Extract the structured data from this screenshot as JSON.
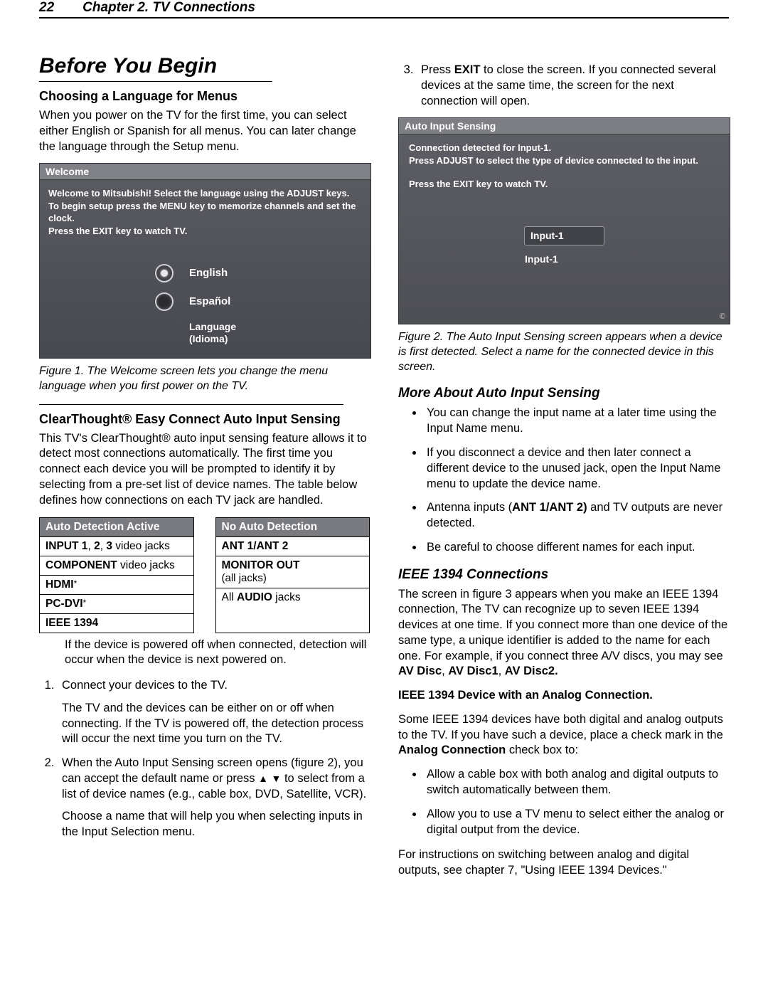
{
  "header": {
    "page_number": "22",
    "chapter": "Chapter 2. TV Connections"
  },
  "left": {
    "h1": "Before You Begin",
    "h2a": "Choosing a Language for Menus",
    "p1": "When you power on the TV for the first time, you can select either English or Spanish for all menus.  You can later change the language through the Setup menu.",
    "fig1": {
      "title": "Welcome",
      "line1": "Welcome to Mitsubishi!  Select the language using the ADJUST keys.",
      "line2": "To begin setup press the MENU key to memorize channels and set the clock.",
      "line3": "Press the EXIT key to watch TV.",
      "opt_english": "English",
      "opt_spanish": "Español",
      "lang_caption1": "Language",
      "lang_caption2": "(Idioma)"
    },
    "fig1_caption": "Figure 1.  The Welcome screen lets you change the menu language when you first power on the TV.",
    "h2b": "ClearThought® Easy Connect Auto Input Sensing",
    "p2": "This TV's ClearThought® auto input sensing feature allows it to detect most connections automatically.  The first time you connect each device you will be prompted to identify it by selecting from a pre-set list of device names.  The table below defines how connections on each TV jack are handled.",
    "tableA": {
      "header": "Auto Detection Active",
      "rows_html": [
        "<b>INPUT 1</b>, <b>2</b>, <b>3</b> video jacks",
        "<b>COMPONENT</b> video jacks",
        "<b>HDMI</b><span class='ast'>*</span>",
        "<b>PC-DVI</b><span class='ast'>*</span>",
        "<b>IEEE 1394</b>"
      ]
    },
    "tableB": {
      "header": "No Auto Detection",
      "rows_html": [
        "<b>ANT 1/ANT 2</b>",
        "<b>MONITOR OUT</b><br><span class='sub'>(all jacks)</span>",
        "All <b>AUDIO</b> jacks"
      ]
    },
    "footnote": "If the device is powered off when connected, detection will occur when the device is next powered on.",
    "step1": "Connect your devices to the TV.",
    "step1b": "The TV and the devices can be either on or off when connecting.  If the TV is powered off, the detection process will occur the next time you turn on the TV.",
    "step2_a": "When the Auto Input Sensing screen opens (figure 2), you can accept the default name or press ",
    "step2_b": " to select from a list of device names (e.g., cable box, DVD, Satellite, VCR).",
    "step2_sub": "Choose a name that will help you when selecting inputs in the Input Selection menu."
  },
  "right": {
    "step3_a": "Press ",
    "step3_exit": "EXIT",
    "step3_b": " to close the screen.  If you connected several devices at the same time, the screen for the next connection will open.",
    "fig2": {
      "title": "Auto Input Sensing",
      "line1": "Connection detected for Input-1.",
      "line2": "Press ADJUST to select the type of device connected to the input.",
      "line3": "Press the EXIT key to watch TV.",
      "input_box": "Input-1",
      "input_label": "Input-1"
    },
    "fig2_caption": "Figure 2.  The Auto Input Sensing screen appears when a device is first detected.  Select a name for the connected device in this screen.",
    "h3a": "More About Auto Input Sensing",
    "bullets_a": [
      "You can change the input name at a later time using the Input Name menu.",
      "If you disconnect a device and then later connect a different device to the unused jack, open the Input Name menu to update the device name.",
      "Antenna inputs (<b>ANT 1/ANT 2)</b> and TV outputs are never detected.",
      "Be careful to choose different names for each input."
    ],
    "h3b": "IEEE 1394 Connections",
    "p3": "The screen in figure 3 appears when you make an IEEE 1394 connection,  The TV can recognize up to seven IEEE 1394 devices at one time.  If you connect more than one device of the same type, a unique identifier is added to the name for each one.  For example, if you connect three A/V discs, you may see <b>AV Disc</b>, <b>AV Disc1</b>, <b>AV Disc2.</b>",
    "h4": "IEEE 1394 Device with an Analog Connection.",
    "p4": "Some IEEE 1394 devices have both digital and analog outputs to the TV.  If you have such a device, place a check mark in the <b>Analog Connection</b> check box to:",
    "bullets_b": [
      "Allow a cable box with both analog and digital outputs to switch automatically between them.",
      "Allow you to use a TV menu to select either the analog or digital output from the device."
    ],
    "p5": "For instructions on switching between analog and digital outputs, see chapter 7, \"Using IEEE 1394 Devices.\""
  }
}
